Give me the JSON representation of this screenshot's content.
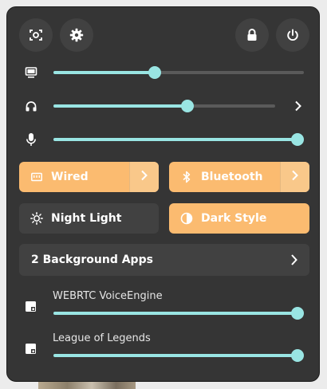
{
  "top_buttons": {
    "screenshot_icon": "screenshot-icon",
    "settings_icon": "gear-icon",
    "lock_icon": "lock-icon",
    "power_icon": "power-icon"
  },
  "sliders": {
    "display_brightness": {
      "icon": "display-icon",
      "level": 0.4
    },
    "headphone_volume": {
      "icon": "headphones-icon",
      "level": 0.61
    },
    "microphone_volume": {
      "icon": "microphone-icon",
      "level": 1.0
    }
  },
  "toggles": {
    "wired": {
      "label": "Wired",
      "active": true
    },
    "bluetooth": {
      "label": "Bluetooth",
      "active": true
    },
    "night_light": {
      "label": "Night Light",
      "active": false
    },
    "dark_style": {
      "label": "Dark Style",
      "active": true
    }
  },
  "background_apps": {
    "label": "2 Background Apps"
  },
  "apps": [
    {
      "name": "WEBRTC VoiceEngine",
      "level": 1.0
    },
    {
      "name": "League of Legends",
      "level": 1.0
    }
  ],
  "colors": {
    "accent": "#99e5e3",
    "toggle_on": "#fbbb70",
    "panel": "#353535",
    "button": "#414141"
  }
}
